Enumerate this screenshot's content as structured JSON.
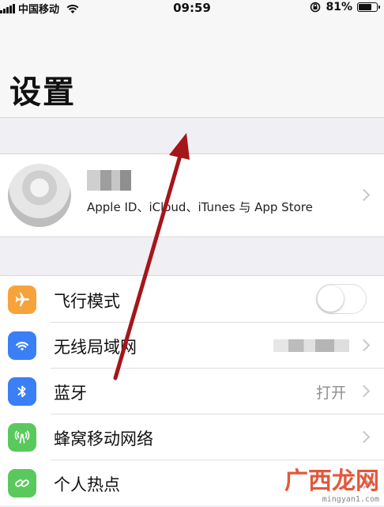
{
  "status_bar": {
    "carrier": "中国移动",
    "time": "09:59",
    "battery_percent_text": "81%",
    "battery_level": 0.81
  },
  "header": {
    "title": "设置"
  },
  "profile": {
    "subtitle": "Apple ID、iCloud、iTunes 与 App Store"
  },
  "settings": [
    {
      "label": "飞行模式",
      "icon": "airplane-icon",
      "color": "#f7a33c",
      "control": "toggle",
      "toggle_on": false
    },
    {
      "label": "无线局域网",
      "icon": "wifi-icon",
      "color": "#3b7ff6",
      "control": "blurred-value"
    },
    {
      "label": "蓝牙",
      "icon": "bluetooth-icon",
      "color": "#3b7ff6",
      "control": "value",
      "value": "打开"
    },
    {
      "label": "蜂窝移动网络",
      "icon": "cellular-icon",
      "color": "#5ac95d",
      "control": "chevron"
    },
    {
      "label": "个人热点",
      "icon": "hotspot-icon",
      "color": "#5ac95d",
      "control": "chevron"
    }
  ],
  "annotation": {
    "arrow_color": "#a4161a"
  },
  "watermark": {
    "main": "广西龙网",
    "sub": "mingyan1.com"
  }
}
